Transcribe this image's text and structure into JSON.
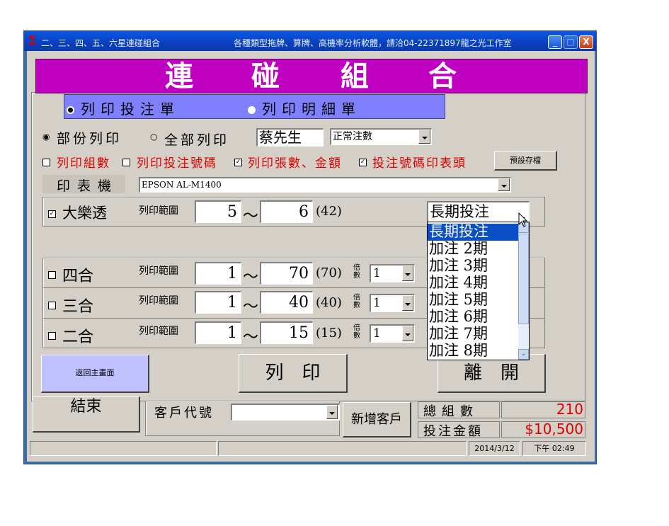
{
  "window": {
    "title_left": "二、三、四、五、六星連碰組合",
    "title_right": "各種類型拖牌、算牌、高機率分析軟體，請洽04-22371897龍之光工作室",
    "icon": "sigma-icon",
    "buttons": {
      "minimize": "_",
      "maximize": "□",
      "close": "X"
    }
  },
  "banner": {
    "chars": [
      "連",
      "碰",
      "組",
      "合"
    ],
    "color": "#c000c0"
  },
  "print_mode": {
    "option1": "列印投注單",
    "option2": "列印明細單",
    "selected": "option1"
  },
  "print_scope": {
    "partial": "部份列印",
    "all": "全部列印",
    "selected": "partial",
    "customer_name": "蔡先生",
    "bet_type_select": "正常注數"
  },
  "print_options": {
    "opt_groups": "列印組數",
    "opt_numbers": "列印投注號碼",
    "opt_sheets_amount": "列印張數、金額",
    "opt_header": "投注號碼印表頭",
    "checked": [
      "opt_sheets_amount",
      "opt_header"
    ],
    "save_default_button": "預設存檔"
  },
  "printer": {
    "label": "印表機",
    "value": "EPSON AL-M1400"
  },
  "lottery": {
    "name": "大樂透",
    "checked": true,
    "range_label": "列印範圍",
    "from": "5",
    "tilde": "～",
    "to": "6",
    "total": "(42)",
    "term_select": "長期投注"
  },
  "combos": [
    {
      "name": "四合",
      "range_label": "列印範圍",
      "from": "1",
      "to": "70",
      "total": "(70)",
      "multiplier_label": "倍數",
      "multiplier": "1"
    },
    {
      "name": "三合",
      "range_label": "列印範圍",
      "from": "1",
      "to": "40",
      "total": "(40)",
      "multiplier_label": "倍數",
      "multiplier": "1"
    },
    {
      "name": "二合",
      "range_label": "列印範圍",
      "from": "1",
      "to": "15",
      "total": "(15)",
      "multiplier_label": "倍數",
      "multiplier": "1"
    }
  ],
  "term_dropdown": {
    "items": [
      "長期投注",
      "加注 2期",
      "加注 3期",
      "加注 4期",
      "加注 5期",
      "加注 6期",
      "加注 7期",
      "加注 8期"
    ],
    "selected_index": 0
  },
  "buttons": {
    "back_main": "返回主畫面",
    "print": "列　印",
    "leave": "離　開",
    "finish": "結束"
  },
  "customer": {
    "code_label": "客戶代號",
    "code_value": "",
    "add_button": "新增客戶"
  },
  "summary": {
    "total_groups_label": "總組數",
    "total_groups_value": "210",
    "bet_amount_label": "投注金額",
    "bet_amount_value": "$10,500",
    "value_color": "#e00000"
  },
  "status": {
    "date": "2014/3/12",
    "time": "下午 02:49"
  }
}
